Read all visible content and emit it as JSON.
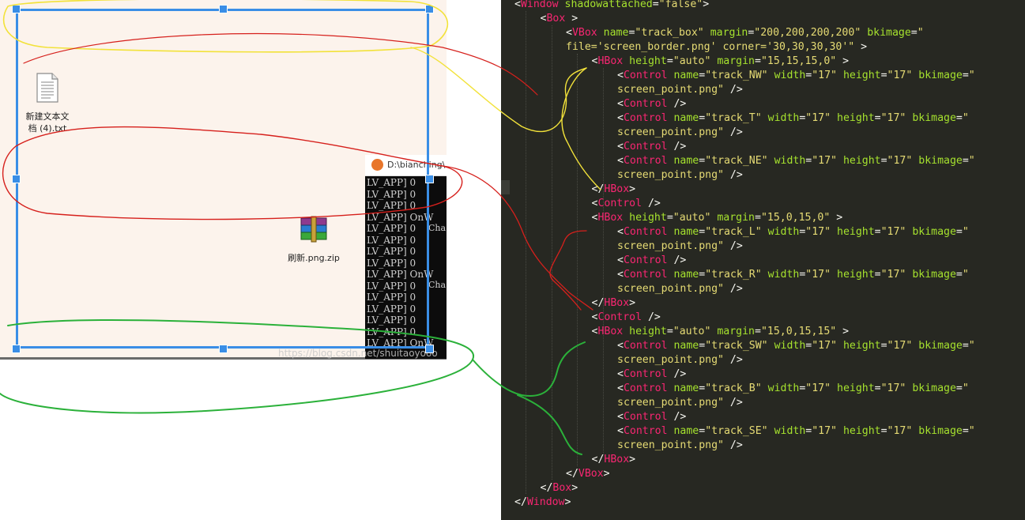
{
  "desktop": {
    "icons": [
      {
        "name": "txt-file",
        "label_line1": "新建文本文",
        "label_line2": "档 (4).txt"
      },
      {
        "name": "zip-file",
        "label_line1": "刷新.png.zip"
      }
    ]
  },
  "console": {
    "title": "D:\\bianching\\",
    "lines": "LV_APP] 0\nLV_APP] 0\nLV_APP] 0\nLV_APP] OnW\nLV_APP] 0\nLV_APP] 0\nLV_APP] 0\nLV_APP] 0\nLV_APP] OnW\nLV_APP] 0\nLV_APP] 0\nLV_APP] 0\nLV_APP] 0\nLV_APP] 0\nLV_APP] OnW",
    "side_text": [
      "Cha",
      "Cha"
    ]
  },
  "watermark": "https://blog.csdn.net/shuitaoyooo",
  "colors": {
    "editor_bg": "#272822",
    "tag": "#f92672",
    "attribute": "#a6e22e",
    "string": "#e6db74",
    "selection_frame": "#3a8ee6",
    "annotation_yellow": "#f2e23a",
    "annotation_red": "#d6201c",
    "annotation_green": "#2bb13a"
  },
  "code": [
    {
      "indent": 0,
      "tokens": [
        [
          "p",
          "<"
        ],
        [
          "t",
          "Window"
        ],
        [
          "p",
          " "
        ],
        [
          "a",
          "shadowattached"
        ],
        [
          "p",
          "="
        ],
        [
          "s",
          "\"false\""
        ],
        [
          "p",
          ">"
        ]
      ]
    },
    {
      "indent": 1,
      "tokens": [
        [
          "p",
          "<"
        ],
        [
          "t",
          "Box"
        ],
        [
          "p",
          " >"
        ]
      ]
    },
    {
      "indent": 2,
      "tokens": [
        [
          "p",
          "<"
        ],
        [
          "t",
          "VBox"
        ],
        [
          "p",
          " "
        ],
        [
          "a",
          "name"
        ],
        [
          "p",
          "="
        ],
        [
          "s",
          "\"track_box\""
        ],
        [
          "p",
          " "
        ],
        [
          "a",
          "margin"
        ],
        [
          "p",
          "="
        ],
        [
          "s",
          "\"200,200,200,200\""
        ],
        [
          "p",
          " "
        ],
        [
          "a",
          "bkimage"
        ],
        [
          "p",
          "="
        ],
        [
          "s",
          "\""
        ]
      ]
    },
    {
      "indent": 2,
      "tokens": [
        [
          "s",
          "file='screen_border.png' corner='30,30,30,30'\""
        ],
        [
          "p",
          " >"
        ]
      ]
    },
    {
      "indent": 3,
      "tokens": [
        [
          "p",
          "<"
        ],
        [
          "t",
          "HBox"
        ],
        [
          "p",
          " "
        ],
        [
          "a",
          "height"
        ],
        [
          "p",
          "="
        ],
        [
          "s",
          "\"auto\""
        ],
        [
          "p",
          " "
        ],
        [
          "a",
          "margin"
        ],
        [
          "p",
          "="
        ],
        [
          "s",
          "\"15,15,15,0\""
        ],
        [
          "p",
          " >"
        ]
      ]
    },
    {
      "indent": 4,
      "tokens": [
        [
          "p",
          "<"
        ],
        [
          "t",
          "Control"
        ],
        [
          "p",
          " "
        ],
        [
          "a",
          "name"
        ],
        [
          "p",
          "="
        ],
        [
          "s",
          "\"track_NW\""
        ],
        [
          "p",
          " "
        ],
        [
          "a",
          "width"
        ],
        [
          "p",
          "="
        ],
        [
          "s",
          "\"17\""
        ],
        [
          "p",
          " "
        ],
        [
          "a",
          "height"
        ],
        [
          "p",
          "="
        ],
        [
          "s",
          "\"17\""
        ],
        [
          "p",
          " "
        ],
        [
          "a",
          "bkimage"
        ],
        [
          "p",
          "="
        ],
        [
          "s",
          "\""
        ]
      ]
    },
    {
      "indent": 4,
      "tokens": [
        [
          "s",
          "screen_point.png\""
        ],
        [
          "p",
          " />"
        ]
      ]
    },
    {
      "indent": 4,
      "tokens": [
        [
          "p",
          "<"
        ],
        [
          "t",
          "Control"
        ],
        [
          "p",
          " />"
        ]
      ]
    },
    {
      "indent": 4,
      "tokens": [
        [
          "p",
          "<"
        ],
        [
          "t",
          "Control"
        ],
        [
          "p",
          " "
        ],
        [
          "a",
          "name"
        ],
        [
          "p",
          "="
        ],
        [
          "s",
          "\"track_T\""
        ],
        [
          "p",
          " "
        ],
        [
          "a",
          "width"
        ],
        [
          "p",
          "="
        ],
        [
          "s",
          "\"17\""
        ],
        [
          "p",
          " "
        ],
        [
          "a",
          "height"
        ],
        [
          "p",
          "="
        ],
        [
          "s",
          "\"17\""
        ],
        [
          "p",
          " "
        ],
        [
          "a",
          "bkimage"
        ],
        [
          "p",
          "="
        ],
        [
          "s",
          "\""
        ]
      ]
    },
    {
      "indent": 4,
      "tokens": [
        [
          "s",
          "screen_point.png\""
        ],
        [
          "p",
          " />"
        ]
      ]
    },
    {
      "indent": 4,
      "tokens": [
        [
          "p",
          "<"
        ],
        [
          "t",
          "Control"
        ],
        [
          "p",
          " />"
        ]
      ]
    },
    {
      "indent": 4,
      "tokens": [
        [
          "p",
          "<"
        ],
        [
          "t",
          "Control"
        ],
        [
          "p",
          " "
        ],
        [
          "a",
          "name"
        ],
        [
          "p",
          "="
        ],
        [
          "s",
          "\"track_NE\""
        ],
        [
          "p",
          " "
        ],
        [
          "a",
          "width"
        ],
        [
          "p",
          "="
        ],
        [
          "s",
          "\"17\""
        ],
        [
          "p",
          " "
        ],
        [
          "a",
          "height"
        ],
        [
          "p",
          "="
        ],
        [
          "s",
          "\"17\""
        ],
        [
          "p",
          " "
        ],
        [
          "a",
          "bkimage"
        ],
        [
          "p",
          "="
        ],
        [
          "s",
          "\""
        ]
      ]
    },
    {
      "indent": 4,
      "tokens": [
        [
          "s",
          "screen_point.png\""
        ],
        [
          "p",
          " />"
        ]
      ]
    },
    {
      "indent": 3,
      "tokens": [
        [
          "p",
          "</"
        ],
        [
          "t",
          "HBox"
        ],
        [
          "p",
          ">"
        ]
      ]
    },
    {
      "indent": 3,
      "tokens": [
        [
          "p",
          "<"
        ],
        [
          "t",
          "Control"
        ],
        [
          "p",
          " />"
        ]
      ]
    },
    {
      "indent": 3,
      "tokens": [
        [
          "p",
          "<"
        ],
        [
          "t",
          "HBox"
        ],
        [
          "p",
          " "
        ],
        [
          "a",
          "height"
        ],
        [
          "p",
          "="
        ],
        [
          "s",
          "\"auto\""
        ],
        [
          "p",
          " "
        ],
        [
          "a",
          "margin"
        ],
        [
          "p",
          "="
        ],
        [
          "s",
          "\"15,0,15,0\""
        ],
        [
          "p",
          " >"
        ]
      ]
    },
    {
      "indent": 4,
      "tokens": [
        [
          "p",
          "<"
        ],
        [
          "t",
          "Control"
        ],
        [
          "p",
          " "
        ],
        [
          "a",
          "name"
        ],
        [
          "p",
          "="
        ],
        [
          "s",
          "\"track_L\""
        ],
        [
          "p",
          " "
        ],
        [
          "a",
          "width"
        ],
        [
          "p",
          "="
        ],
        [
          "s",
          "\"17\""
        ],
        [
          "p",
          " "
        ],
        [
          "a",
          "height"
        ],
        [
          "p",
          "="
        ],
        [
          "s",
          "\"17\""
        ],
        [
          "p",
          " "
        ],
        [
          "a",
          "bkimage"
        ],
        [
          "p",
          "="
        ],
        [
          "s",
          "\""
        ]
      ]
    },
    {
      "indent": 4,
      "tokens": [
        [
          "s",
          "screen_point.png\""
        ],
        [
          "p",
          " />"
        ]
      ]
    },
    {
      "indent": 4,
      "tokens": [
        [
          "p",
          "<"
        ],
        [
          "t",
          "Control"
        ],
        [
          "p",
          " />"
        ]
      ]
    },
    {
      "indent": 4,
      "tokens": [
        [
          "p",
          "<"
        ],
        [
          "t",
          "Control"
        ],
        [
          "p",
          " "
        ],
        [
          "a",
          "name"
        ],
        [
          "p",
          "="
        ],
        [
          "s",
          "\"track_R\""
        ],
        [
          "p",
          " "
        ],
        [
          "a",
          "width"
        ],
        [
          "p",
          "="
        ],
        [
          "s",
          "\"17\""
        ],
        [
          "p",
          " "
        ],
        [
          "a",
          "height"
        ],
        [
          "p",
          "="
        ],
        [
          "s",
          "\"17\""
        ],
        [
          "p",
          " "
        ],
        [
          "a",
          "bkimage"
        ],
        [
          "p",
          "="
        ],
        [
          "s",
          "\""
        ]
      ]
    },
    {
      "indent": 4,
      "tokens": [
        [
          "s",
          "screen_point.png\""
        ],
        [
          "p",
          " />"
        ]
      ]
    },
    {
      "indent": 3,
      "tokens": [
        [
          "p",
          "</"
        ],
        [
          "t",
          "HBox"
        ],
        [
          "p",
          ">"
        ]
      ]
    },
    {
      "indent": 3,
      "tokens": [
        [
          "p",
          "<"
        ],
        [
          "t",
          "Control"
        ],
        [
          "p",
          " />"
        ]
      ]
    },
    {
      "indent": 3,
      "tokens": [
        [
          "p",
          "<"
        ],
        [
          "t",
          "HBox"
        ],
        [
          "p",
          " "
        ],
        [
          "a",
          "height"
        ],
        [
          "p",
          "="
        ],
        [
          "s",
          "\"auto\""
        ],
        [
          "p",
          " "
        ],
        [
          "a",
          "margin"
        ],
        [
          "p",
          "="
        ],
        [
          "s",
          "\"15,0,15,15\""
        ],
        [
          "p",
          " >"
        ]
      ]
    },
    {
      "indent": 4,
      "tokens": [
        [
          "p",
          "<"
        ],
        [
          "t",
          "Control"
        ],
        [
          "p",
          " "
        ],
        [
          "a",
          "name"
        ],
        [
          "p",
          "="
        ],
        [
          "s",
          "\"track_SW\""
        ],
        [
          "p",
          " "
        ],
        [
          "a",
          "width"
        ],
        [
          "p",
          "="
        ],
        [
          "s",
          "\"17\""
        ],
        [
          "p",
          " "
        ],
        [
          "a",
          "height"
        ],
        [
          "p",
          "="
        ],
        [
          "s",
          "\"17\""
        ],
        [
          "p",
          " "
        ],
        [
          "a",
          "bkimage"
        ],
        [
          "p",
          "="
        ],
        [
          "s",
          "\""
        ]
      ]
    },
    {
      "indent": 4,
      "tokens": [
        [
          "s",
          "screen_point.png\""
        ],
        [
          "p",
          " />"
        ]
      ]
    },
    {
      "indent": 4,
      "tokens": [
        [
          "p",
          "<"
        ],
        [
          "t",
          "Control"
        ],
        [
          "p",
          " />"
        ]
      ]
    },
    {
      "indent": 4,
      "tokens": [
        [
          "p",
          "<"
        ],
        [
          "t",
          "Control"
        ],
        [
          "p",
          " "
        ],
        [
          "a",
          "name"
        ],
        [
          "p",
          "="
        ],
        [
          "s",
          "\"track_B\""
        ],
        [
          "p",
          " "
        ],
        [
          "a",
          "width"
        ],
        [
          "p",
          "="
        ],
        [
          "s",
          "\"17\""
        ],
        [
          "p",
          " "
        ],
        [
          "a",
          "height"
        ],
        [
          "p",
          "="
        ],
        [
          "s",
          "\"17\""
        ],
        [
          "p",
          " "
        ],
        [
          "a",
          "bkimage"
        ],
        [
          "p",
          "="
        ],
        [
          "s",
          "\""
        ]
      ]
    },
    {
      "indent": 4,
      "tokens": [
        [
          "s",
          "screen_point.png\""
        ],
        [
          "p",
          " />"
        ]
      ]
    },
    {
      "indent": 4,
      "tokens": [
        [
          "p",
          "<"
        ],
        [
          "t",
          "Control"
        ],
        [
          "p",
          " />"
        ]
      ]
    },
    {
      "indent": 4,
      "tokens": [
        [
          "p",
          "<"
        ],
        [
          "t",
          "Control"
        ],
        [
          "p",
          " "
        ],
        [
          "a",
          "name"
        ],
        [
          "p",
          "="
        ],
        [
          "s",
          "\"track_SE\""
        ],
        [
          "p",
          " "
        ],
        [
          "a",
          "width"
        ],
        [
          "p",
          "="
        ],
        [
          "s",
          "\"17\""
        ],
        [
          "p",
          " "
        ],
        [
          "a",
          "height"
        ],
        [
          "p",
          "="
        ],
        [
          "s",
          "\"17\""
        ],
        [
          "p",
          " "
        ],
        [
          "a",
          "bkimage"
        ],
        [
          "p",
          "="
        ],
        [
          "s",
          "\""
        ]
      ]
    },
    {
      "indent": 4,
      "tokens": [
        [
          "s",
          "screen_point.png\""
        ],
        [
          "p",
          " />"
        ]
      ]
    },
    {
      "indent": 3,
      "tokens": [
        [
          "p",
          "</"
        ],
        [
          "t",
          "HBox"
        ],
        [
          "p",
          ">"
        ]
      ]
    },
    {
      "indent": 2,
      "tokens": [
        [
          "p",
          "</"
        ],
        [
          "t",
          "VBox"
        ],
        [
          "p",
          ">"
        ]
      ]
    },
    {
      "indent": 1,
      "tokens": [
        [
          "p",
          "</"
        ],
        [
          "t",
          "Box"
        ],
        [
          "p",
          ">"
        ]
      ]
    },
    {
      "indent": 0,
      "tokens": [
        [
          "p",
          "</"
        ],
        [
          "t",
          "Window"
        ],
        [
          "p",
          ">"
        ]
      ]
    }
  ]
}
